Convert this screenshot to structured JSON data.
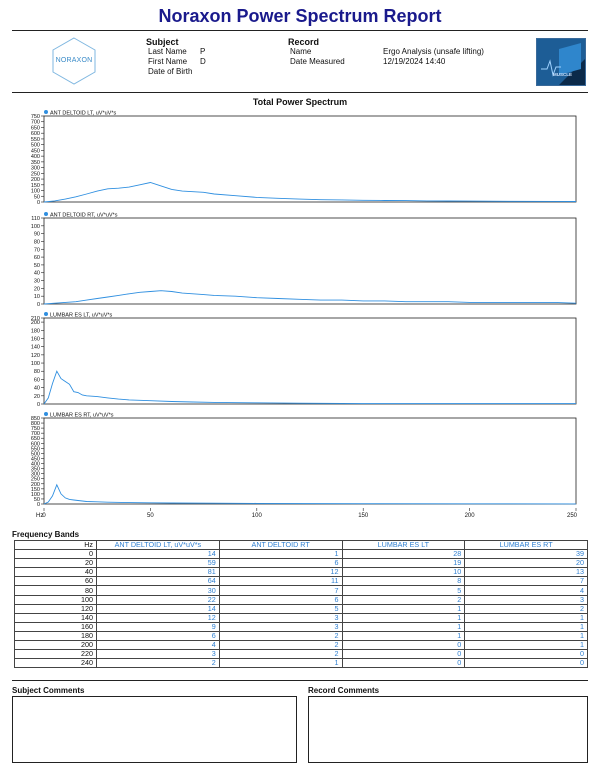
{
  "report": {
    "title": "Noraxon Power Spectrum Report",
    "logo_text": "NORAXON",
    "badge_text": "MUSCLE"
  },
  "subject": {
    "heading": "Subject",
    "last_name_label": "Last Name",
    "last_name": "P",
    "first_name_label": "First Name",
    "first_name": "D",
    "dob_label": "Date of Birth",
    "dob": ""
  },
  "record": {
    "heading": "Record",
    "name_label": "Name",
    "name": "Ergo Analysis (unsafe lifting)",
    "date_label": "Date Measured",
    "date": "12/19/2024 14:40"
  },
  "colors": {
    "trace": "#2f8fe0",
    "title": "#1a1a8c",
    "header_text": "#2f7fd0"
  },
  "chart_data": {
    "type": "line",
    "title": "Total Power Spectrum",
    "xlabel": "Hz",
    "xlim": [
      0,
      250
    ],
    "xticks": [
      0,
      50,
      100,
      150,
      200,
      250
    ],
    "panels": [
      {
        "name": "ANT DELTOID LT, uV*uV*s",
        "ylim": [
          0,
          750
        ],
        "yticks": [
          0,
          50,
          100,
          150,
          200,
          250,
          300,
          350,
          400,
          450,
          500,
          550,
          600,
          650,
          700,
          750
        ],
        "x": [
          0,
          5,
          10,
          15,
          20,
          25,
          30,
          35,
          40,
          45,
          50,
          55,
          60,
          65,
          70,
          75,
          80,
          90,
          100,
          110,
          120,
          130,
          140,
          150,
          160,
          170,
          180,
          190,
          200,
          220,
          240,
          250
        ],
        "y": [
          0,
          10,
          25,
          45,
          70,
          95,
          115,
          120,
          130,
          150,
          170,
          140,
          110,
          95,
          90,
          85,
          70,
          55,
          40,
          32,
          25,
          20,
          18,
          15,
          13,
          12,
          10,
          9,
          8,
          6,
          5,
          4
        ]
      },
      {
        "name": "ANT DELTOID RT, uV*uV*s",
        "ylim": [
          0,
          110
        ],
        "yticks": [
          0,
          10,
          20,
          30,
          40,
          50,
          60,
          70,
          80,
          90,
          100,
          110
        ],
        "x": [
          0,
          5,
          10,
          15,
          20,
          25,
          30,
          35,
          40,
          45,
          50,
          55,
          60,
          65,
          70,
          75,
          80,
          90,
          100,
          110,
          120,
          130,
          140,
          150,
          160,
          170,
          180,
          190,
          200,
          220,
          240,
          250
        ],
        "y": [
          0,
          1,
          2,
          3,
          5,
          7,
          9,
          11,
          13,
          15,
          16,
          17,
          16,
          14,
          13,
          12,
          11,
          10,
          8,
          7,
          6,
          5,
          5,
          4,
          4,
          3,
          3,
          3,
          2,
          2,
          2,
          1
        ]
      },
      {
        "name": "LUMBAR ES LT, uV*uV*s",
        "ylim": [
          0,
          210
        ],
        "yticks": [
          0,
          20,
          40,
          60,
          80,
          100,
          120,
          140,
          160,
          180,
          200,
          210
        ],
        "x": [
          0,
          2,
          4,
          6,
          8,
          10,
          12,
          14,
          16,
          18,
          20,
          25,
          30,
          35,
          40,
          50,
          60,
          70,
          80,
          100,
          120,
          150,
          180,
          200,
          250
        ],
        "y": [
          0,
          15,
          50,
          80,
          62,
          55,
          48,
          30,
          28,
          22,
          20,
          18,
          15,
          12,
          10,
          8,
          6,
          5,
          4,
          3,
          2,
          1,
          1,
          1,
          1
        ]
      },
      {
        "name": "LUMBAR ES RT, uV*uV*s",
        "ylim": [
          0,
          850
        ],
        "yticks": [
          0,
          50,
          100,
          150,
          200,
          250,
          300,
          350,
          400,
          450,
          500,
          550,
          600,
          650,
          700,
          750,
          800,
          850
        ],
        "x": [
          0,
          2,
          4,
          6,
          8,
          10,
          12,
          14,
          16,
          18,
          20,
          25,
          30,
          40,
          50,
          60,
          80,
          100,
          150,
          200,
          250
        ],
        "y": [
          0,
          20,
          80,
          190,
          100,
          60,
          45,
          40,
          35,
          30,
          25,
          22,
          18,
          14,
          12,
          10,
          8,
          6,
          3,
          2,
          1
        ]
      }
    ]
  },
  "frequency_bands": {
    "title": "Frequency Bands",
    "columns": [
      "Hz",
      "ANT DELTOID LT, uV*uV*s",
      "ANT DELTOID RT",
      "LUMBAR ES LT",
      "LUMBAR ES RT"
    ],
    "rows": [
      [
        "0",
        "14",
        "1",
        "28",
        "39"
      ],
      [
        "20",
        "59",
        "6",
        "19",
        "20"
      ],
      [
        "40",
        "81",
        "12",
        "10",
        "13"
      ],
      [
        "60",
        "64",
        "11",
        "8",
        "7"
      ],
      [
        "80",
        "30",
        "7",
        "5",
        "4"
      ],
      [
        "100",
        "22",
        "6",
        "2",
        "3"
      ],
      [
        "120",
        "14",
        "5",
        "1",
        "2"
      ],
      [
        "140",
        "12",
        "3",
        "1",
        "1"
      ],
      [
        "160",
        "9",
        "3",
        "1",
        "1"
      ],
      [
        "180",
        "6",
        "2",
        "1",
        "1"
      ],
      [
        "200",
        "4",
        "2",
        "0",
        "1"
      ],
      [
        "220",
        "3",
        "2",
        "0",
        "0"
      ],
      [
        "240",
        "2",
        "1",
        "0",
        "0"
      ]
    ]
  },
  "comments": {
    "subject_title": "Subject Comments",
    "record_title": "Record Comments"
  }
}
